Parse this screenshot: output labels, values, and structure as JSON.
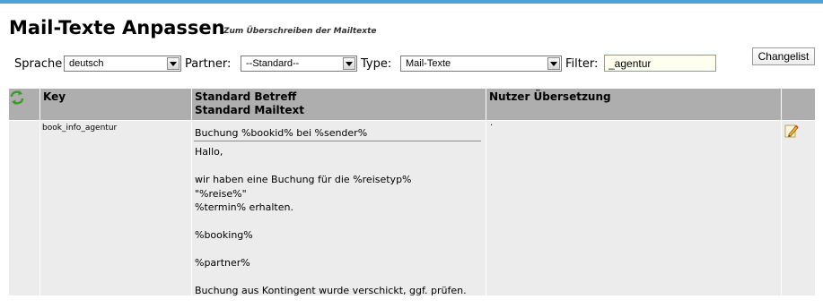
{
  "page": {
    "title": "Mail-Texte Anpassen",
    "subtitle": "Zum Überschreiben der Mailtexte"
  },
  "filters": {
    "sprache_label": "Sprache",
    "sprache_value": "deutsch",
    "partner_label": "Partner:",
    "partner_value": "--Standard--",
    "type_label": "Type:",
    "type_value": "Mail-Texte",
    "filter_label": "Filter:",
    "filter_value": "_agentur",
    "changelist_label": "Changelist"
  },
  "table": {
    "headers": {
      "refresh_icon": "refresh-icon",
      "key": "Key",
      "standard_betreff": "Standard Betreff",
      "standard_mailtext": "Standard Mailtext",
      "nutzer_uebersetzung": "Nutzer Übersetzung"
    },
    "rows": [
      {
        "key": "book_info_agentur",
        "subject": "Buchung %bookid% bei %sender%",
        "mailtext": "Hallo,\n\nwir haben eine Buchung für die %reisetyp%\n\"%reise%\"\n%termin% erhalten.\n\n%booking%\n\n%partner%\n\nBuchung aus Kontingent wurde verschickt, ggf. prüfen.",
        "user_translation": "·",
        "edit_icon": "pencil-icon"
      }
    ]
  },
  "colors": {
    "topbar": "#4ea0d8",
    "header_bg": "#aeaeae",
    "row_bg": "#ececec"
  }
}
